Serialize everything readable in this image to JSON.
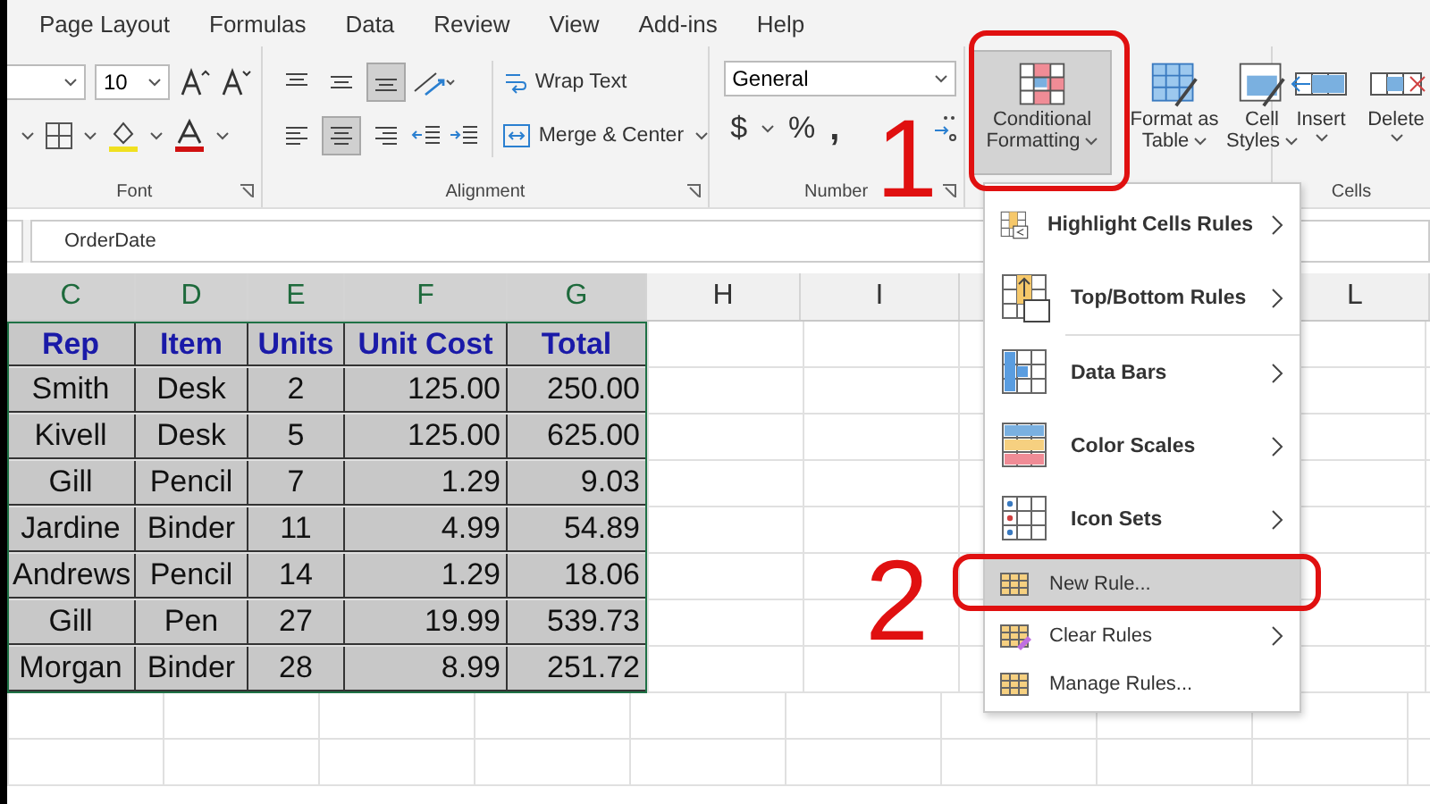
{
  "menu_tabs": [
    "Page Layout",
    "Formulas",
    "Data",
    "Review",
    "View",
    "Add-ins",
    "Help"
  ],
  "ribbon": {
    "font": {
      "size": "10",
      "label": "Font"
    },
    "alignment": {
      "vertical": [
        {
          "kind": "top",
          "selected": false
        },
        {
          "kind": "middle",
          "selected": false
        },
        {
          "kind": "bottom",
          "selected": true
        }
      ],
      "horizontal": [
        {
          "kind": "left",
          "selected": false
        },
        {
          "kind": "center",
          "selected": true
        },
        {
          "kind": "right",
          "selected": false
        }
      ],
      "wrap_text": "Wrap Text",
      "merge_center": "Merge & Center",
      "label": "Alignment"
    },
    "number": {
      "format": "General",
      "symbols": [
        "$",
        "%",
        ","
      ],
      "label": "Number"
    },
    "styles": [
      {
        "lines": [
          "Conditional",
          "Formatting"
        ],
        "selected": true
      },
      {
        "lines": [
          "Format as",
          "Table"
        ],
        "selected": false
      },
      {
        "lines": [
          "Cell",
          "Styles"
        ],
        "selected": false
      }
    ],
    "cells": {
      "buttons": [
        "Insert",
        "Delete"
      ],
      "label": "Cells"
    }
  },
  "formula_bar": {
    "value": "OrderDate"
  },
  "sheet": {
    "columns": [
      {
        "letter": "C",
        "selected": true
      },
      {
        "letter": "D",
        "selected": true
      },
      {
        "letter": "E",
        "selected": true
      },
      {
        "letter": "F",
        "selected": true
      },
      {
        "letter": "G",
        "selected": true
      },
      {
        "letter": "H",
        "selected": false
      },
      {
        "letter": "I",
        "selected": false
      },
      {
        "letter": "L",
        "selected": false
      }
    ],
    "header_row": [
      "Rep",
      "Item",
      "Units",
      "Unit Cost",
      "Total"
    ],
    "rows": [
      [
        "Smith",
        "Desk",
        "2",
        "125.00",
        "250.00"
      ],
      [
        "Kivell",
        "Desk",
        "5",
        "125.00",
        "625.00"
      ],
      [
        "Gill",
        "Pencil",
        "7",
        "1.29",
        "9.03"
      ],
      [
        "Jardine",
        "Binder",
        "11",
        "4.99",
        "54.89"
      ],
      [
        "Andrews",
        "Pencil",
        "14",
        "1.29",
        "18.06"
      ],
      [
        "Gill",
        "Pen",
        "27",
        "19.99",
        "539.73"
      ],
      [
        "Morgan",
        "Binder",
        "28",
        "8.99",
        "251.72"
      ]
    ]
  },
  "menu": {
    "items": [
      {
        "label": "Highlight Cells Rules",
        "kind": "highlight",
        "submenu": true,
        "selected": false
      },
      {
        "label": "Top/Bottom Rules",
        "kind": "topbottom",
        "submenu": true,
        "selected": false
      },
      {
        "label": "Data Bars",
        "kind": "databars",
        "submenu": true,
        "selected": false
      },
      {
        "label": "Color Scales",
        "kind": "colorscales",
        "submenu": true,
        "selected": false
      },
      {
        "label": "Icon Sets",
        "kind": "iconsets",
        "submenu": true,
        "selected": false
      },
      {
        "label": "New Rule...",
        "kind": "newrule",
        "submenu": false,
        "selected": true
      },
      {
        "label": "Clear Rules",
        "kind": "clearrules",
        "submenu": true,
        "selected": false
      },
      {
        "label": "Manage Rules...",
        "kind": "managerules",
        "submenu": false,
        "selected": false
      }
    ]
  },
  "annotations": [
    "1",
    "2"
  ]
}
